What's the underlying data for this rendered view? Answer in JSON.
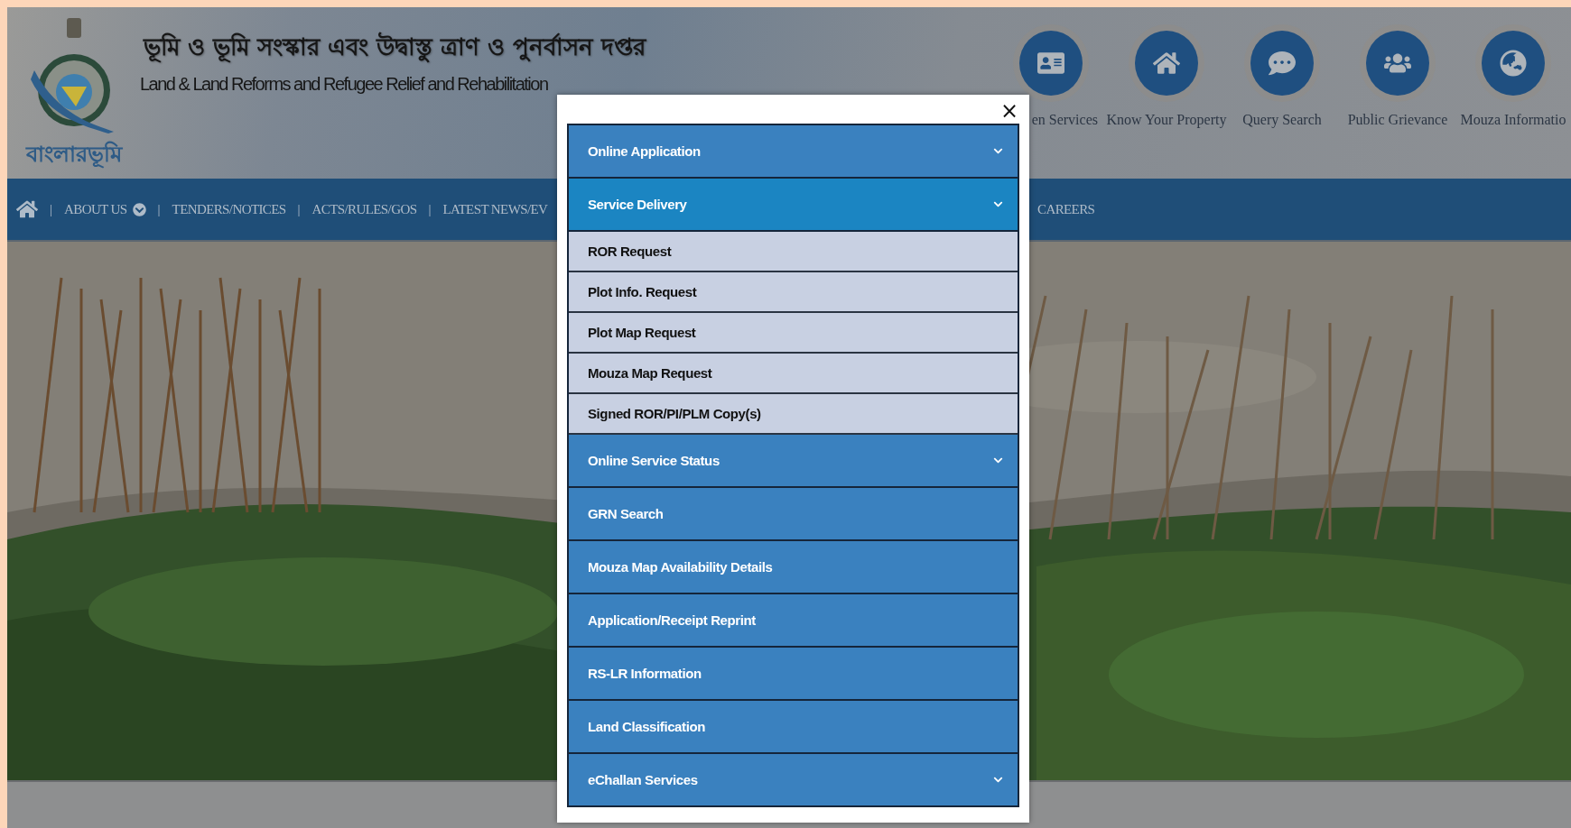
{
  "header": {
    "title_bengali": "ভূমি ও ভূমি সংস্কার এবং উদ্বাস্তু ত্রাণ ও পুনর্বাসন দপ্তর",
    "title_english": "Land & Land Reforms and Refugee Relief and Rehabilitation",
    "logo_caption": "বাংলারভূমি"
  },
  "quick_links": [
    {
      "label": "en Services"
    },
    {
      "label": "Know Your Property"
    },
    {
      "label": "Query Search"
    },
    {
      "label": "Public Grievance"
    },
    {
      "label": "Mouza Informatio"
    }
  ],
  "nav": {
    "separator": "|",
    "items": [
      {
        "label": "ABOUT US",
        "kind": "dropdown"
      },
      {
        "label": "TENDERS/NOTICES",
        "kind": "link"
      },
      {
        "label": "ACTS/RULES/GOS",
        "kind": "link"
      },
      {
        "label": "LATEST NEWS/EV",
        "kind": "link"
      }
    ],
    "right_items": [
      {
        "label": "CAREERS"
      }
    ]
  },
  "modal": {
    "close": "×",
    "menu": [
      {
        "label": "Online Application",
        "kind": "dropdown",
        "expanded": false
      },
      {
        "label": "Service Delivery",
        "kind": "dropdown",
        "expanded": true,
        "children": [
          {
            "label": "ROR Request"
          },
          {
            "label": "Plot Info. Request"
          },
          {
            "label": "Plot Map Request"
          },
          {
            "label": "Mouza Map Request"
          },
          {
            "label": "Signed ROR/PI/PLM Copy(s)"
          }
        ]
      },
      {
        "label": "Online Service Status",
        "kind": "dropdown",
        "expanded": false
      },
      {
        "label": "GRN Search",
        "kind": "link"
      },
      {
        "label": "Mouza Map Availability Details",
        "kind": "link"
      },
      {
        "label": "Application/Receipt Reprint",
        "kind": "link"
      },
      {
        "label": "RS-LR Information",
        "kind": "link"
      },
      {
        "label": "Land Classification",
        "kind": "link"
      },
      {
        "label": "eChallan Services",
        "kind": "dropdown",
        "expanded": false
      }
    ]
  }
}
